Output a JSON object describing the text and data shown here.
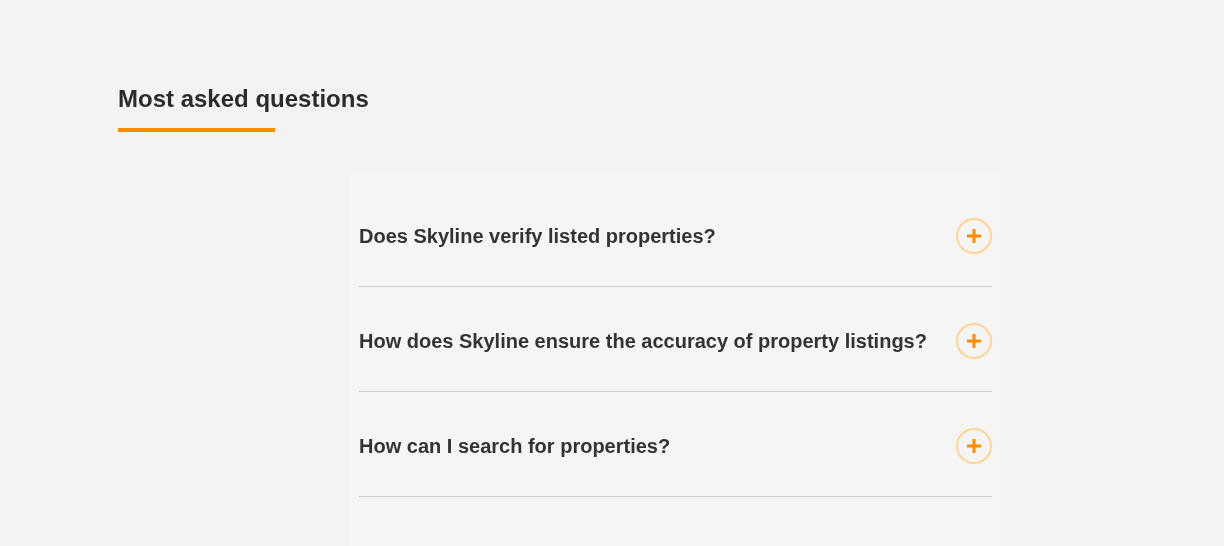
{
  "section": {
    "title": "Most asked questions"
  },
  "faqs": [
    {
      "question": "Does Skyline verify listed properties?",
      "expanded": false
    },
    {
      "question": "How does Skyline ensure the accuracy of property listings?",
      "expanded": false
    },
    {
      "question": "How can I search for properties?",
      "expanded": false
    }
  ]
}
